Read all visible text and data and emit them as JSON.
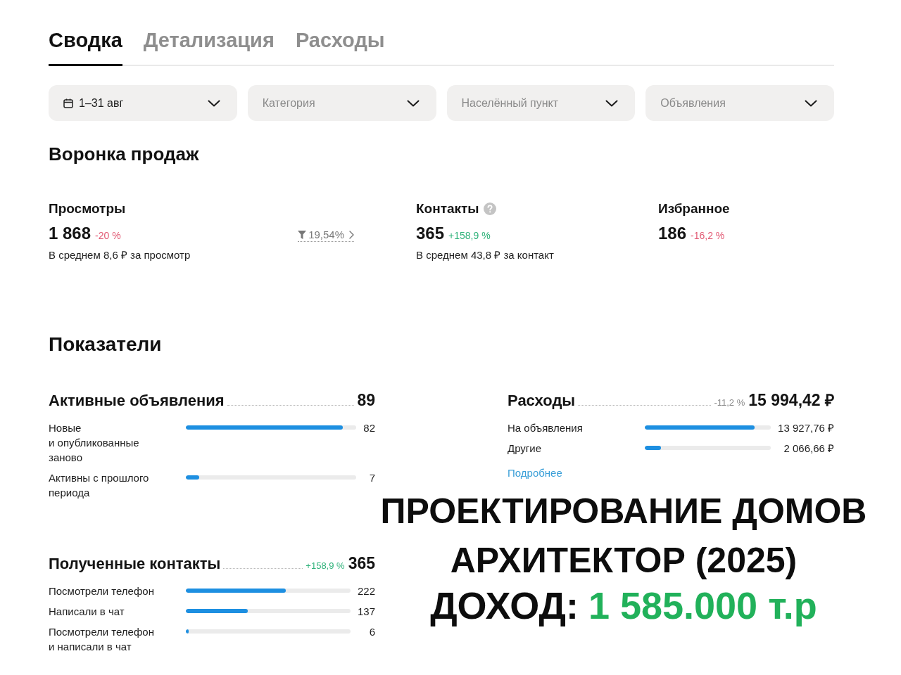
{
  "tabs": [
    {
      "label": "Сводка",
      "selected": true
    },
    {
      "label": "Детализация",
      "selected": false
    },
    {
      "label": "Расходы",
      "selected": false
    }
  ],
  "filters": [
    {
      "kind": "date",
      "value": "1–31 авг"
    },
    {
      "kind": "select",
      "placeholder": "Категория"
    },
    {
      "kind": "select",
      "placeholder": "Населённый пункт"
    },
    {
      "kind": "select",
      "placeholder": "Объявления"
    }
  ],
  "funnel": {
    "title": "Воронка продаж",
    "metrics": [
      {
        "title": "Просмотры",
        "help": false,
        "value": "1 868",
        "change": "-20 %",
        "color": "#e25a74",
        "conversion": "19,54%",
        "note": "В среднем 8,6 ₽ за просмотр"
      },
      {
        "title": "Контакты",
        "help": true,
        "value": "365",
        "change": "+158,9 %",
        "color": "#2fb27a",
        "note": "В среднем 43,8 ₽ за контакт"
      },
      {
        "title": "Избранное",
        "help": false,
        "value": "186",
        "change": "-16,2 %",
        "color": "#e25a74"
      }
    ]
  },
  "indicators": {
    "title": "Показатели",
    "sections": [
      {
        "title": "Активные объявления",
        "total": "89",
        "rows": [
          {
            "label": "Новые и опубликованные заново",
            "value": "82",
            "level": 0.921
          },
          {
            "label": "Активны с прошлого периода",
            "value": "7",
            "level": 0.079
          }
        ]
      },
      {
        "title": "Расходы",
        "change": "-11,2 %",
        "color": "#8a8a8a",
        "total": "15 994,42 ₽",
        "rows": [
          {
            "label": "На объявления",
            "value": "13 927,76 ₽",
            "level": 0.871
          },
          {
            "label": "Другие",
            "value": "2 066,66 ₽",
            "level": 0.129
          }
        ],
        "link": "Подробнее"
      },
      {
        "title": "Полученные контакты",
        "change": "+158,9 %",
        "color": "#2fb27a",
        "total": "365",
        "rows": [
          {
            "label": "Посмотрели телефон",
            "value": "222",
            "level": 0.608
          },
          {
            "label": "Написали в чат",
            "value": "137",
            "level": 0.375
          },
          {
            "label": "Посмотрели телефон и написали в чат",
            "value": "6",
            "level": 0.016
          }
        ]
      }
    ]
  },
  "caption": {
    "lines": [
      "ПРОЕКТИРОВАНИЕ ДОМОВ",
      "АРХИТЕКТОР (2025)"
    ],
    "income_label": "ДОХОД:",
    "income_value": "1 585.000 т.р"
  }
}
